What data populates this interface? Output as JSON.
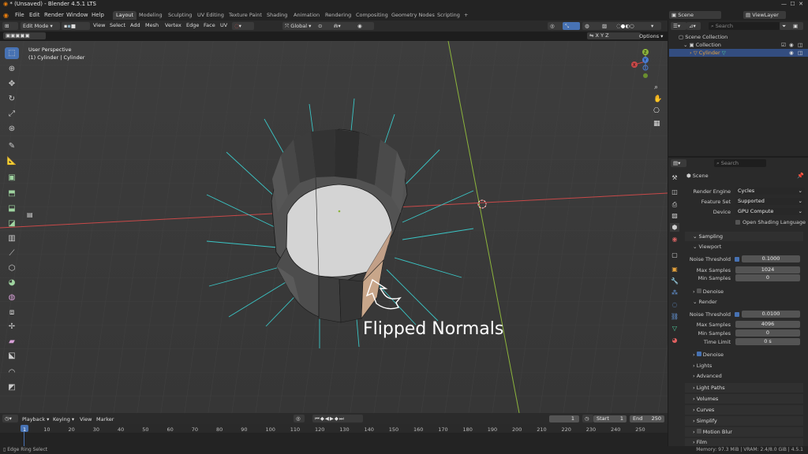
{
  "window_title": "* (Unsaved) - Blender 4.5.1 LTS",
  "menu": [
    "File",
    "Edit",
    "Render",
    "Window",
    "Help"
  ],
  "workspaces": [
    "Layout",
    "Modeling",
    "Sculpting",
    "UV Editing",
    "Texture Paint",
    "Shading",
    "Animation",
    "Rendering",
    "Compositing",
    "Geometry Nodes",
    "Scripting"
  ],
  "active_workspace": "Layout",
  "scene_name": "Scene",
  "view_layer": "ViewLayer",
  "viewport_header": {
    "mode": "Edit Mode",
    "menus": [
      "View",
      "Select",
      "Add",
      "Mesh",
      "Vertex",
      "Edge",
      "Face",
      "UV"
    ],
    "transform_orientation": "Global",
    "options": "Options",
    "axes": [
      "X",
      "Y",
      "Z"
    ]
  },
  "viewport": {
    "view_name": "User Perspective",
    "object_info": "(1) Cylinder | Cylinder",
    "annotation": "Flipped Normals"
  },
  "gizmo": {
    "x": "X",
    "y": "Y",
    "z": "Z"
  },
  "outliner": {
    "search_placeholder": "Search",
    "rows": [
      "Scene Collection",
      "Collection",
      "Cylinder"
    ]
  },
  "properties": {
    "search_placeholder": "Search",
    "context": "Scene",
    "render_engine_label": "Render Engine",
    "render_engine": "Cycles",
    "feature_set_label": "Feature Set",
    "feature_set": "Supported",
    "device_label": "Device",
    "device": "GPU Compute",
    "osl_label": "Open Shading Language",
    "sampling": "Sampling",
    "viewport": "Viewport",
    "vp_noise_threshold_label": "Noise Threshold",
    "vp_noise_threshold": "0.1000",
    "vp_max_samples_label": "Max Samples",
    "vp_max_samples": "1024",
    "vp_min_samples_label": "Min Samples",
    "vp_min_samples": "0",
    "vp_denoise": "Denoise",
    "render": "Render",
    "r_noise_threshold_label": "Noise Threshold",
    "r_noise_threshold": "0.0100",
    "r_max_samples_label": "Max Samples",
    "r_max_samples": "4096",
    "r_min_samples_label": "Min Samples",
    "r_min_samples": "0",
    "r_time_limit_label": "Time Limit",
    "r_time_limit": "0 s",
    "r_denoise": "Denoise",
    "lights": "Lights",
    "advanced": "Advanced",
    "panels": [
      "Light Paths",
      "Volumes",
      "Curves",
      "Simplify",
      "Motion Blur",
      "Film"
    ]
  },
  "timeline": {
    "menus": [
      "Playback",
      "Keying",
      "View",
      "Marker"
    ],
    "current_frame": "1",
    "start_label": "Start",
    "start": "1",
    "end_label": "End",
    "end": "250",
    "ticks": [
      "1",
      "10",
      "20",
      "30",
      "40",
      "50",
      "60",
      "70",
      "80",
      "90",
      "100",
      "110",
      "120",
      "130",
      "140",
      "150",
      "160",
      "170",
      "180",
      "190",
      "200",
      "210",
      "220",
      "230",
      "240",
      "250"
    ]
  },
  "status": {
    "left": "Edge Ring Select",
    "right": "Memory: 97.3 MiB | VRAM: 2.4/8.0 GiB | 4.5.1"
  },
  "colors": {
    "accent": "#4772b3",
    "x_axis": "#c84949",
    "y_axis": "#8cb43c",
    "normals": "#3ac6c6"
  }
}
